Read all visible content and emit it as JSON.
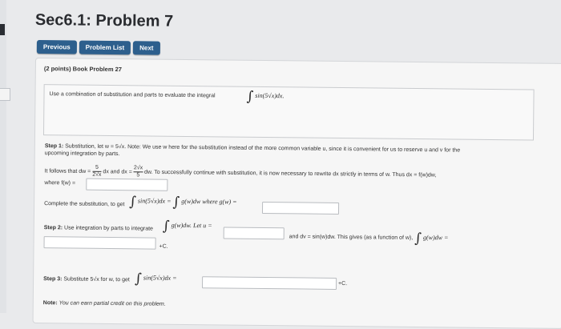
{
  "title": "Sec6.1: Problem 7",
  "nav": {
    "previous": "Previous",
    "problem_list": "Problem List",
    "next": "Next"
  },
  "points": "(2 points) Book Problem 27",
  "problem_text": "Use a combination of substitution and parts to evaluate the integral",
  "integral_expr": "sin(5√x)dx.",
  "step1": {
    "label": "Step 1:",
    "line1": "Substitution, let w = 5√x. Note: We use w here for the substitution instead of the more common variable u, since it is convenient for us to reserve u and v for the",
    "line2": "upcoming integration by parts.",
    "follows_a": "It follows that dw =",
    "frac1_num": "5",
    "frac1_den": "2√x",
    "dx_and": "dx and dx =",
    "frac2_num": "2√x",
    "frac2_den": "5",
    "follows_b": "dw. To successfully continue with substitution, it is now necessary to rewrite dx strictly in terms of w. Thus dx = f(w)dw,",
    "where": "where f(w) =",
    "complete": "Complete the substitution, to get",
    "sub_eq": "sin(5√x)dx =",
    "sub_eq2": "g(w)dw where g(w) ="
  },
  "step2": {
    "label": "Step 2:",
    "text": "Use integration by parts to integrate",
    "expr": "g(w)dw. Let u =",
    "and_dv": "and dv = sin(w)dw. This gives (as a function of w),",
    "expr2": "g(w)dw =",
    "plus_c": "+C."
  },
  "step3": {
    "label": "Step 3:",
    "text": "Substitute 5√x for w, to get",
    "expr": "sin(5√x)dx =",
    "plus_c": "+C."
  },
  "note": {
    "label": "Note:",
    "text": "You can earn partial credit on this problem."
  }
}
